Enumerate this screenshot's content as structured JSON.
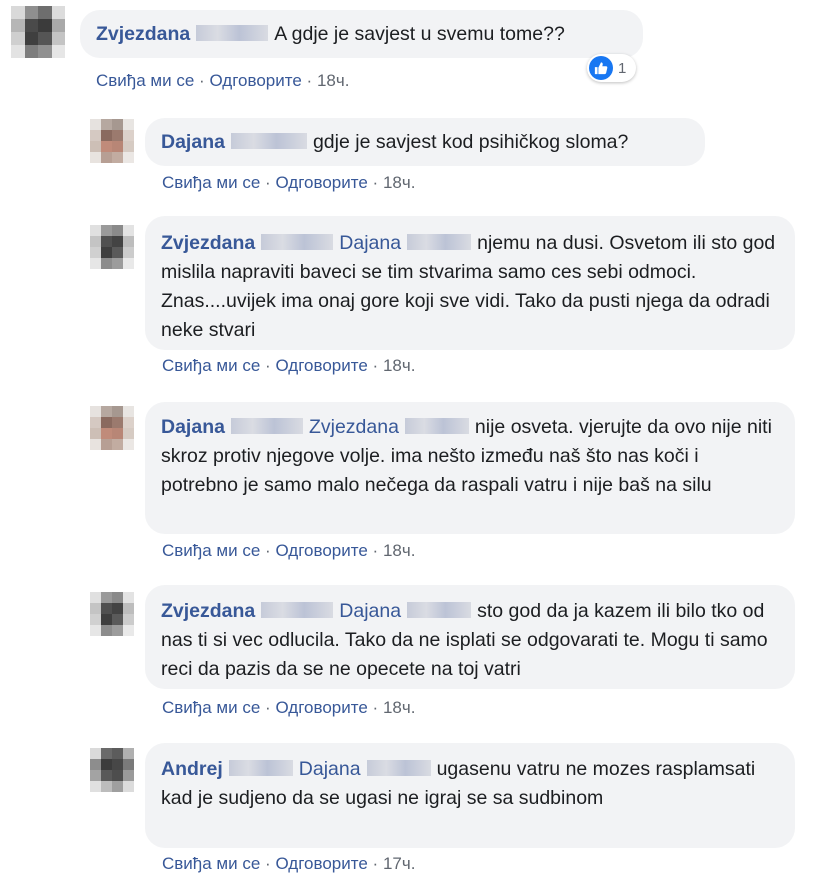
{
  "actions": {
    "like": "Свиђа ми се",
    "reply": "Одговорите",
    "separator": "·"
  },
  "comments": [
    {
      "author": "Zvjezdana",
      "mention": "",
      "text": "A gdje je savjest u svemu tome??",
      "time": "18ч.",
      "reaction_count": "1",
      "reaction_icon": "like-icon"
    },
    {
      "author": "Dajana",
      "mention": "",
      "text": "gdje je savjest kod psihičkog sloma?",
      "time": "18ч."
    },
    {
      "author": "Zvjezdana",
      "mention": "Dajana",
      "text": "njemu na dusi. Osvetom ili sto god mislila napraviti baveci se tim stvarima samo ces sebi odmoci. Znas....uvijek ima onaj gore koji sve vidi. Tako da pusti njega da odradi neke stvari",
      "time": "18ч."
    },
    {
      "author": "Dajana",
      "mention": "Zvjezdana",
      "text": "nije osveta. vjerujte da ovo nije niti skroz protiv njegove volje. ima nešto između naš što nas koči i potrebno je samo malo nečega da raspali vatru i nije baš na silu",
      "time": "18ч."
    },
    {
      "author": "Zvjezdana",
      "mention": "Dajana",
      "text": "sto god da ja kazem ili bilo tko od nas ti si vec odlucila. Tako da ne isplati se odgovarati te. Mogu ti samo reci da pazis da se ne opecete na toj vatri",
      "time": "18ч."
    },
    {
      "author": "Andrej",
      "mention": "Dajana",
      "text": "ugasenu vatru ne mozes rasplamsati kad je sudjeno da se ugasi ne igraj se sa sudbinom",
      "time": "17ч."
    }
  ],
  "colors": {
    "link": "#385898",
    "bubble": "#f2f3f5",
    "meta": "#616770",
    "like_badge": "#1877f2"
  }
}
